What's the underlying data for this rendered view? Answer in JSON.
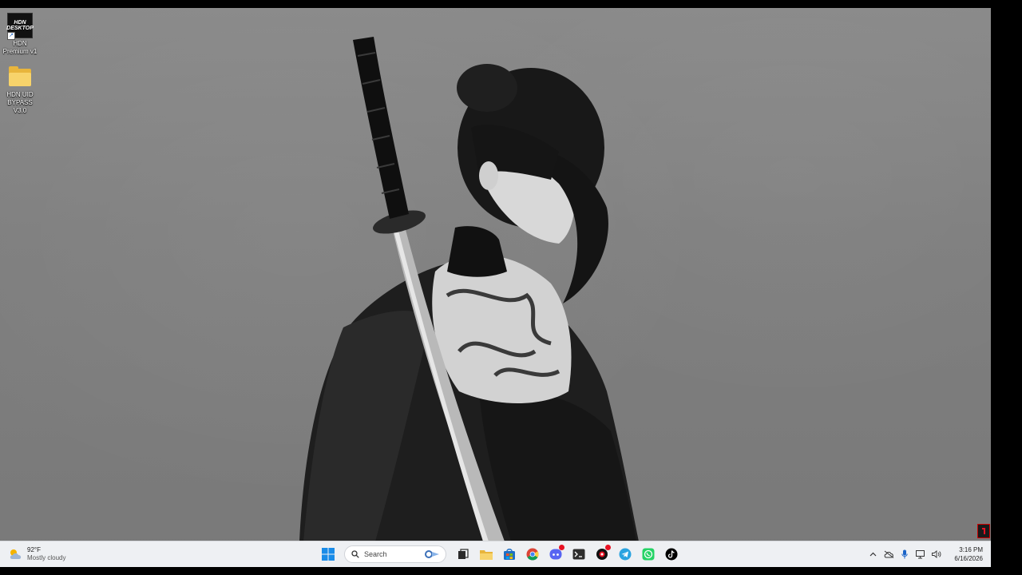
{
  "desktop": {
    "icons": [
      {
        "label": "HDN Premium v1",
        "logo_text": "HDN DESKTOP"
      },
      {
        "label": "HDN UID BYPASS V3.0"
      }
    ]
  },
  "taskbar": {
    "weather": {
      "temp": "92°F",
      "condition": "Mostly cloudy"
    },
    "search": {
      "placeholder": "Search"
    },
    "pinned_apps": [
      "start",
      "search",
      "task-view",
      "file-explorer",
      "microsoft-store",
      "chrome",
      "discord",
      "terminal",
      "app-with-badge",
      "telegram",
      "whatsapp",
      "tiktok"
    ],
    "badges": {
      "discord": "",
      "app": ""
    },
    "clock": {
      "time": "3:16 PM",
      "date": "6/16/2026"
    }
  },
  "colors": {
    "taskbar_bg": "#eef0f3",
    "accent_windows_blue": "#1a8ce8",
    "folder_yellow": "#f7d36b",
    "notification_red": "#e81123"
  }
}
